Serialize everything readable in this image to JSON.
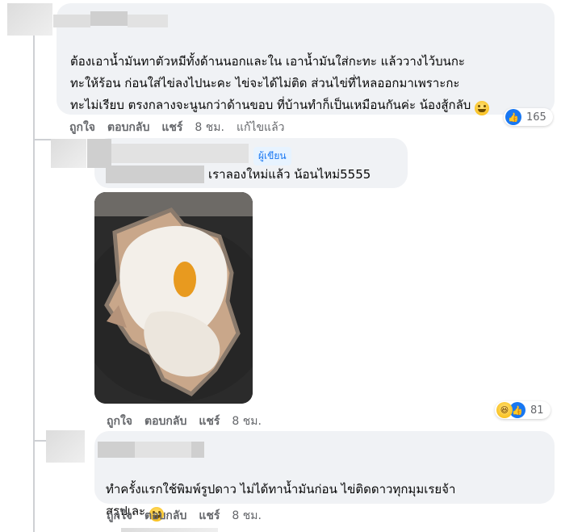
{
  "comments": [
    {
      "text": "ต้องเอาน้ำมันทาตัวหมีทั้งด้านนอกและใน เอาน้ำมันใส่กะทะ แล้ววางไว้บนกะ\nทะให้ร้อน ก่อนใส่ไข่ลงไปนะคะ ไข่จะได้ไม่ติด ส่วนไข่ที่ไหลออกมาเพราะกะ\nทะไม่เรียบ ตรงกลางจะนูนกว่าด้านขอบ ที่บ้านทำก็เป็นเหมือนกันค่ะ น้องสู้กลับ",
      "like_label": "ถูกใจ",
      "reply_label": "ตอบกลับ",
      "share_label": "แชร์",
      "time": "8 ชม.",
      "edited": "แก้ไขแล้ว",
      "reaction_count": "165"
    },
    {
      "author_badge": "ผู้เขียน",
      "text": "เราลองใหม่แล้ว น้อนไหม่5555",
      "like_label": "ถูกใจ",
      "reply_label": "ตอบกลับ",
      "share_label": "แชร์",
      "time": "8 ชม.",
      "reaction_count": "81"
    },
    {
      "text": "ทำครั้งแรกใช้พิมพ์รูปดาว ไม่ได้ทาน้ำมันก่อน ไข่ติดดาวทุกมุมเรยจ้า\nสรุปเละ",
      "like_label": "ถูกใจ",
      "reply_label": "ตอบกลับ",
      "share_label": "แชร์",
      "time": "8 ชม."
    }
  ],
  "colors": {
    "bubble": "#f0f2f5",
    "like_blue": "#1877f2",
    "meta_grey": "#65676b"
  },
  "icons": {
    "like": "like-reaction-icon",
    "haha": "haha-reaction-icon",
    "emoji": "grinning-sweat-emoji-icon"
  }
}
